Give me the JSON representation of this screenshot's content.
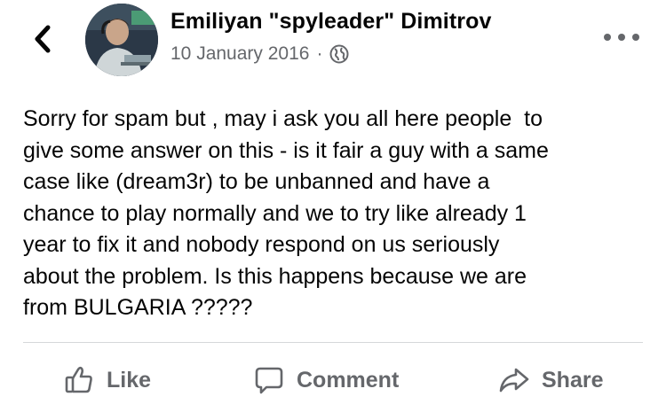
{
  "header": {
    "author_name": "Emiliyan \"spyleader\" Dimitrov",
    "date": "10 January 2016",
    "separator": "·",
    "privacy_icon": "globe-icon",
    "back_icon": "chevron-left-icon",
    "more_icon": "more-horizontal-icon"
  },
  "post": {
    "text": "Sorry for spam but , may i ask you all here people  to\ngive some answer on this - is it fair a guy with a same\ncase like (dream3r) to be unbanned and have a\nchance to play normally and we to try like already 1\nyear to fix it and nobody respond on us seriously\nabout the problem. Is this happens because we are\nfrom BULGARIA ?????"
  },
  "actions": {
    "like_label": "Like",
    "comment_label": "Comment",
    "share_label": "Share",
    "like_icon": "thumbs-up-icon",
    "comment_icon": "comment-bubble-icon",
    "share_icon": "share-arrow-icon"
  },
  "colors": {
    "text_primary": "#050505",
    "text_secondary": "#65676b",
    "divider": "#d5d7da",
    "background": "#ffffff"
  }
}
